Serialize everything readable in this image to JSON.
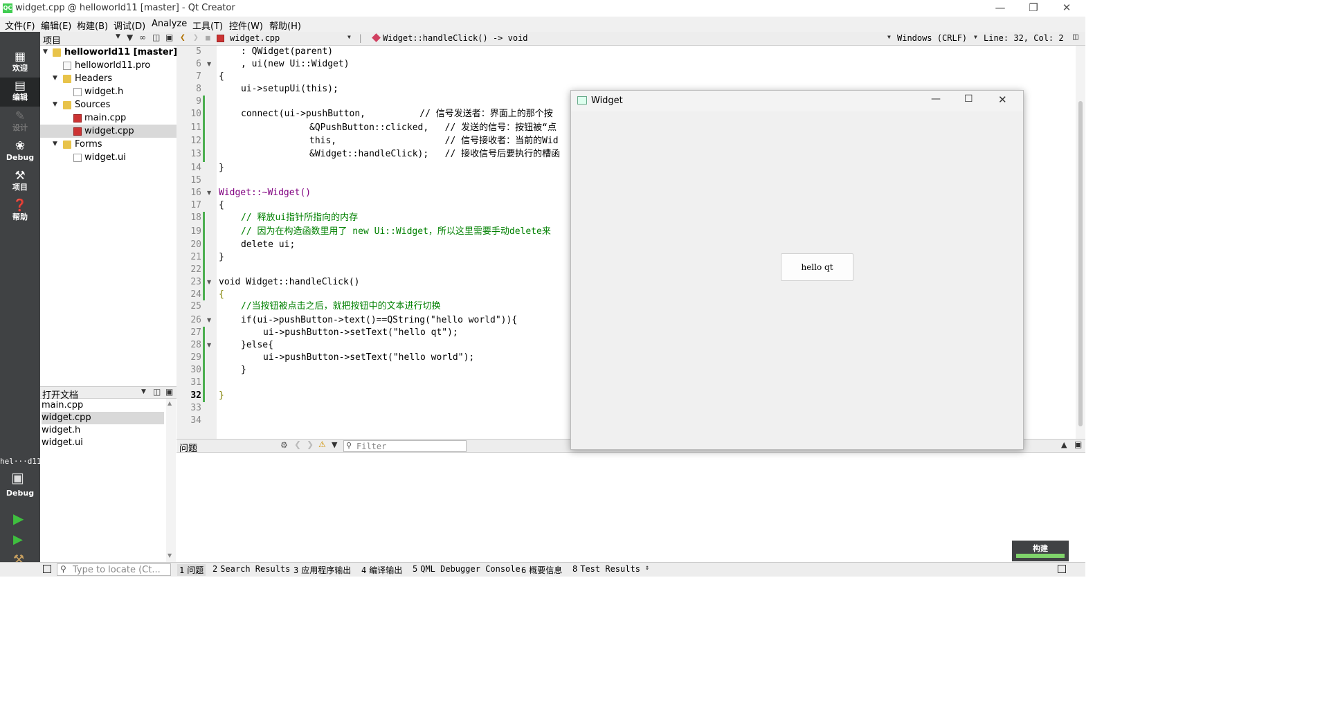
{
  "window": {
    "title": "widget.cpp @ helloworld11 [master] - Qt Creator",
    "app_icon": "QC"
  },
  "menu": [
    "文件(F)",
    "编辑(E)",
    "构建(B)",
    "调试(D)",
    "Analyze",
    "工具(T)",
    "控件(W)",
    "帮助(H)"
  ],
  "modes": [
    {
      "label": "欢迎",
      "icon": "grid-icon"
    },
    {
      "label": "编辑",
      "icon": "edit-icon"
    },
    {
      "label": "设计",
      "icon": "pencil-icon"
    },
    {
      "label": "Debug",
      "icon": "bug-icon"
    },
    {
      "label": "项目",
      "icon": "wrench-icon"
    },
    {
      "label": "帮助",
      "icon": "help-icon"
    }
  ],
  "kit": {
    "project": "hel···d11",
    "config": "Debug"
  },
  "project_pane": {
    "title": "项目",
    "tree": [
      {
        "label": "helloworld11 [master]",
        "level": 0
      },
      {
        "label": "helloworld11.pro",
        "level": 1
      },
      {
        "label": "Headers",
        "level": 1
      },
      {
        "label": "widget.h",
        "level": 2
      },
      {
        "label": "Sources",
        "level": 1
      },
      {
        "label": "main.cpp",
        "level": 2
      },
      {
        "label": "widget.cpp",
        "level": 2
      },
      {
        "label": "Forms",
        "level": 1
      },
      {
        "label": "widget.ui",
        "level": 2
      }
    ]
  },
  "open_docs": {
    "title": "打开文档",
    "items": [
      "main.cpp",
      "widget.cpp",
      "widget.h",
      "widget.ui"
    ]
  },
  "editor": {
    "file": "widget.cpp",
    "function": "Widget::handleClick() -> void",
    "line_ending": "Windows (CRLF)",
    "position": "Line: 32, Col: 2",
    "lines": [
      {
        "n": "5",
        "text": ""
      },
      {
        "n": "6",
        "text": ""
      },
      {
        "n": "7",
        "text": ""
      },
      {
        "n": "8",
        "text": ""
      },
      {
        "n": "9",
        "text": ""
      },
      {
        "n": "10",
        "text": ""
      },
      {
        "n": "11",
        "text": ""
      },
      {
        "n": "12",
        "text": ""
      },
      {
        "n": "13",
        "text": ""
      },
      {
        "n": "14",
        "text": ""
      },
      {
        "n": "15",
        "text": ""
      },
      {
        "n": "16",
        "text": ""
      },
      {
        "n": "17",
        "text": ""
      },
      {
        "n": "18",
        "text": ""
      },
      {
        "n": "19",
        "text": ""
      },
      {
        "n": "20",
        "text": ""
      },
      {
        "n": "21",
        "text": ""
      },
      {
        "n": "22",
        "text": ""
      },
      {
        "n": "23",
        "text": ""
      },
      {
        "n": "24",
        "text": ""
      },
      {
        "n": "25",
        "text": ""
      },
      {
        "n": "26",
        "text": ""
      },
      {
        "n": "27",
        "text": ""
      },
      {
        "n": "28",
        "text": ""
      },
      {
        "n": "29",
        "text": ""
      },
      {
        "n": "30",
        "text": ""
      },
      {
        "n": "31",
        "text": ""
      },
      {
        "n": "32",
        "text": ""
      },
      {
        "n": "33",
        "text": ""
      },
      {
        "n": "34",
        "text": ""
      }
    ],
    "code": [
      ": QWidget(parent)",
      ", ui(new Ui::Widget)",
      "{",
      "ui->setupUi(this);",
      "",
      "connect(ui->pushButton,          // 信号发送者：界面上的那个按",
      "&QPushButton::clicked,   // 发送的信号：按钮被“点",
      "this,                    // 信号接收者：当前的Wid",
      "&Widget::handleClick);   // 接收信号后要执行的槽函",
      "}",
      "",
      "Widget::~Widget()",
      "{",
      "// 释放ui指针所指向的内存",
      "// 因为在构造函数里用了 new Ui::Widget，所以这里需要手动delete来",
      "delete ui;",
      "}",
      "",
      "void Widget::handleClick()",
      "{",
      "//当按钮被点击之后，就把按钮中的文本进行切换",
      "if(ui->pushButton->text()==QString(\"hello world\")){",
      "ui->pushButton->setText(\"hello qt\");",
      "}else{",
      "ui->pushButton->setText(\"hello world\");",
      "}",
      "",
      "}",
      "",
      ""
    ]
  },
  "widget_window": {
    "title": "Widget",
    "button_label": "hello qt"
  },
  "issues": {
    "title": "问题",
    "filter_placeholder": "Filter"
  },
  "build_badge": "构建",
  "statusbar": {
    "locate_placeholder": "Type to locate (Ct...",
    "panes": [
      {
        "num": "1",
        "label": "问题"
      },
      {
        "num": "2",
        "label": "Search Results"
      },
      {
        "num": "3",
        "label": "应用程序输出"
      },
      {
        "num": "4",
        "label": "编译输出"
      },
      {
        "num": "5",
        "label": "QML Debugger Console"
      },
      {
        "num": "6",
        "label": "概要信息"
      },
      {
        "num": "8",
        "label": "Test Results"
      }
    ]
  },
  "colors": {
    "mode_bar": "#404244",
    "accent_green": "#41cd52",
    "keyword": "#808000",
    "type": "#800080",
    "function": "#00677c",
    "string": "#008000",
    "comment": "#008000"
  }
}
